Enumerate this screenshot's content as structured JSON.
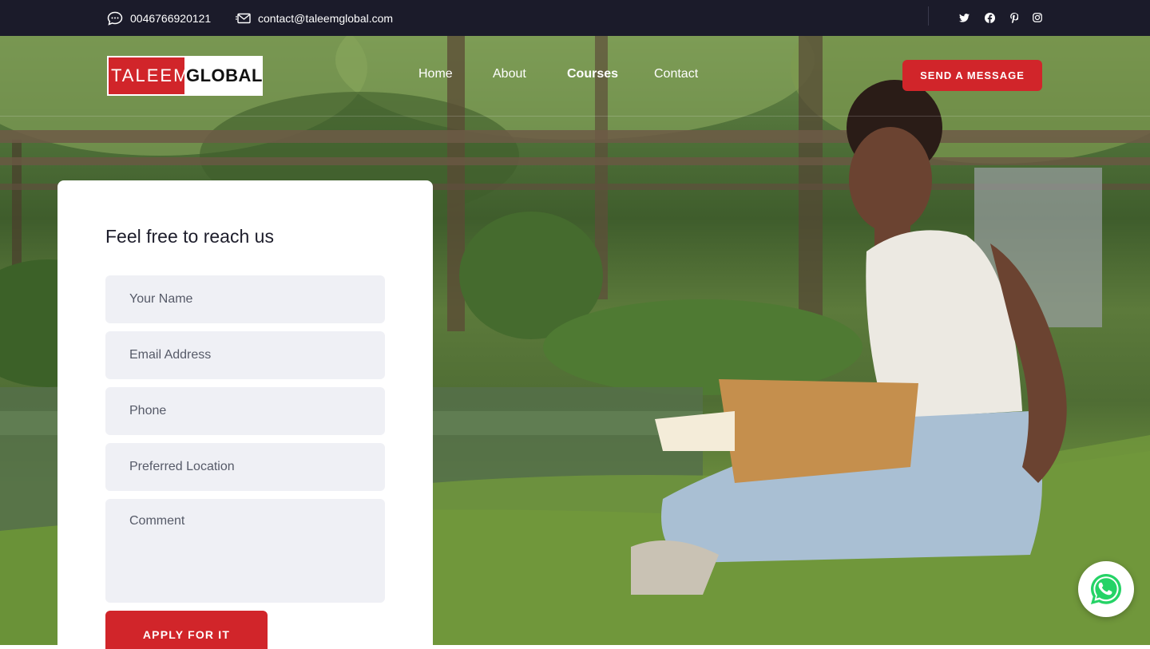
{
  "topbar": {
    "phone": "0046766920121",
    "email": "contact@taleemglobal.com",
    "social": [
      "twitter-icon",
      "facebook-icon",
      "pinterest-icon",
      "instagram-icon"
    ]
  },
  "header": {
    "logo_part1": "TALEEM",
    "logo_part2": "GLOBAL",
    "nav": [
      "Home",
      "About",
      "Courses",
      "Contact"
    ],
    "active_nav": "Courses",
    "cta_label": "SEND A MESSAGE"
  },
  "form": {
    "title": "Feel free to reach us",
    "name_placeholder": "Your Name",
    "email_placeholder": "Email Address",
    "phone_placeholder": "Phone",
    "location_placeholder": "Preferred Location",
    "comment_placeholder": "Comment",
    "submit_label": "APPLY FOR IT"
  },
  "colors": {
    "accent": "#d1252a",
    "topbar": "#1b1b2a",
    "field_bg": "#eff0f5",
    "whatsapp": "#25d366"
  }
}
